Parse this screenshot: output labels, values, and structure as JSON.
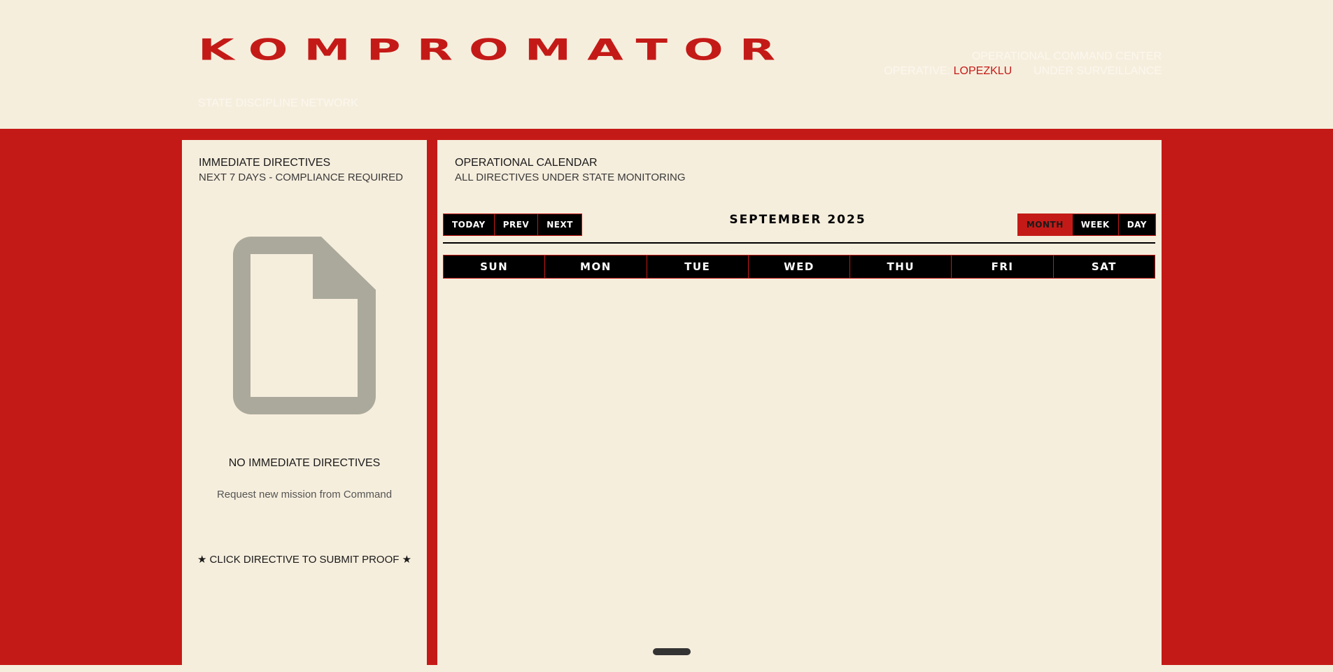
{
  "header": {
    "logo": "KOMPROMATOR",
    "tagline": "STATE DISCIPLINE NETWORK",
    "command_center": "OPERATIONAL COMMAND CENTER",
    "operative_label": "OPERATIVE:",
    "operative_name": "LOPEZKLU",
    "status": "UNDER SURVEILLANCE"
  },
  "directives": {
    "title": "IMMEDIATE DIRECTIVES",
    "subtitle": "NEXT 7 DAYS - COMPLIANCE REQUIRED",
    "empty_icon": "document-icon",
    "empty_title": "NO IMMEDIATE DIRECTIVES",
    "empty_subtitle": "Request new mission from Command",
    "hint": "★ CLICK DIRECTIVE TO SUBMIT PROOF ★"
  },
  "calendar": {
    "title": "OPERATIONAL CALENDAR",
    "subtitle": "ALL DIRECTIVES UNDER STATE MONITORING",
    "nav": {
      "today": "TODAY",
      "prev": "PREV",
      "next": "NEXT"
    },
    "month_label": "SEPTEMBER 2025",
    "views": {
      "month": "MONTH",
      "week": "WEEK",
      "day": "DAY"
    },
    "active_view": "month",
    "weekdays": [
      "SUN",
      "MON",
      "TUE",
      "WED",
      "THU",
      "FRI",
      "SAT"
    ]
  },
  "colors": {
    "accent": "#c41a17",
    "background": "#f6eedd",
    "button": "#000000",
    "muted_icon": "#aba99b"
  }
}
